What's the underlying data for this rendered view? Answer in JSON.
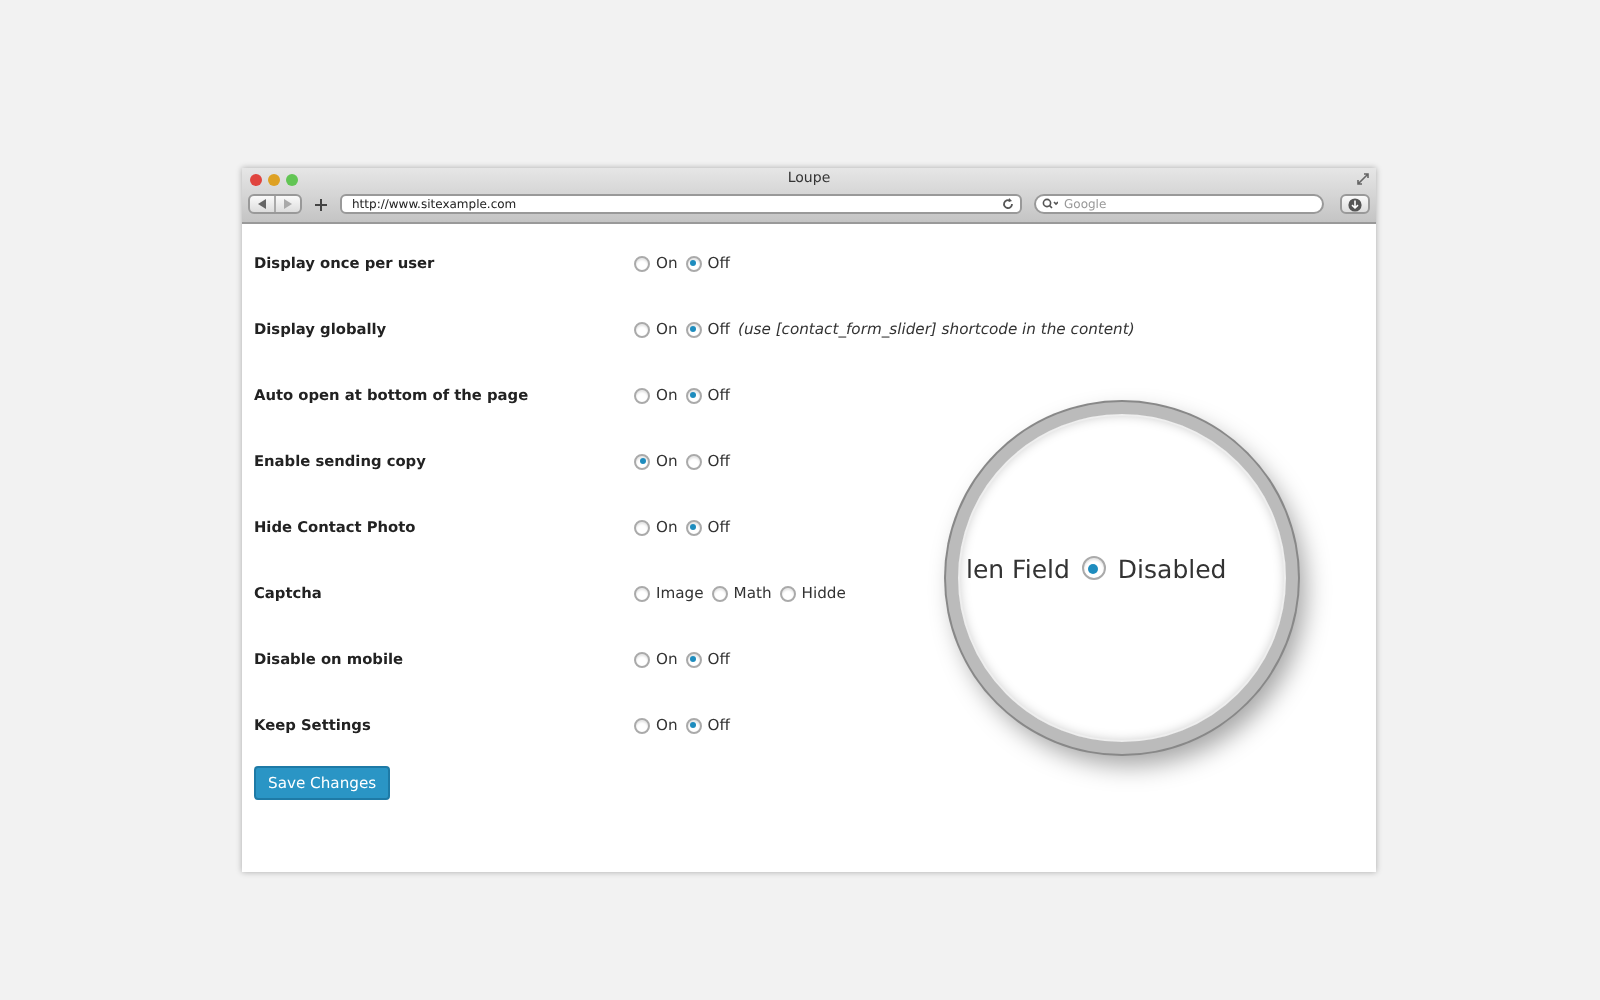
{
  "window": {
    "title": "Loupe",
    "address": "http://www.sitexample.com",
    "search": {
      "placeholder": "Google"
    }
  },
  "settings": [
    {
      "label": "Display once per user",
      "options": [
        {
          "label": "On",
          "selected": false
        },
        {
          "label": "Off",
          "selected": true
        }
      ]
    },
    {
      "label": "Display globally",
      "options": [
        {
          "label": "On",
          "selected": false
        },
        {
          "label": "Off",
          "selected": true
        }
      ],
      "note": "(use [contact_form_slider] shortcode in the content)"
    },
    {
      "label": "Auto open at bottom of the page",
      "options": [
        {
          "label": "On",
          "selected": false
        },
        {
          "label": "Off",
          "selected": true
        }
      ]
    },
    {
      "label": "Enable sending copy",
      "options": [
        {
          "label": "On",
          "selected": true
        },
        {
          "label": "Off",
          "selected": false
        }
      ]
    },
    {
      "label": "Hide Contact Photo",
      "options": [
        {
          "label": "On",
          "selected": false
        },
        {
          "label": "Off",
          "selected": true
        }
      ]
    },
    {
      "label": "Captcha",
      "options": [
        {
          "label": "Image",
          "selected": false
        },
        {
          "label": "Math",
          "selected": false
        },
        {
          "label": "Hidde",
          "selected": false
        }
      ]
    },
    {
      "label": "Disable on mobile",
      "options": [
        {
          "label": "On",
          "selected": false
        },
        {
          "label": "Off",
          "selected": true
        }
      ]
    },
    {
      "label": "Keep Settings",
      "options": [
        {
          "label": "On",
          "selected": false
        },
        {
          "label": "Off",
          "selected": true
        }
      ]
    }
  ],
  "save_button": "Save Changes",
  "magnifier": {
    "text": "len Field",
    "option": {
      "label": "Disabled",
      "selected": true
    }
  }
}
